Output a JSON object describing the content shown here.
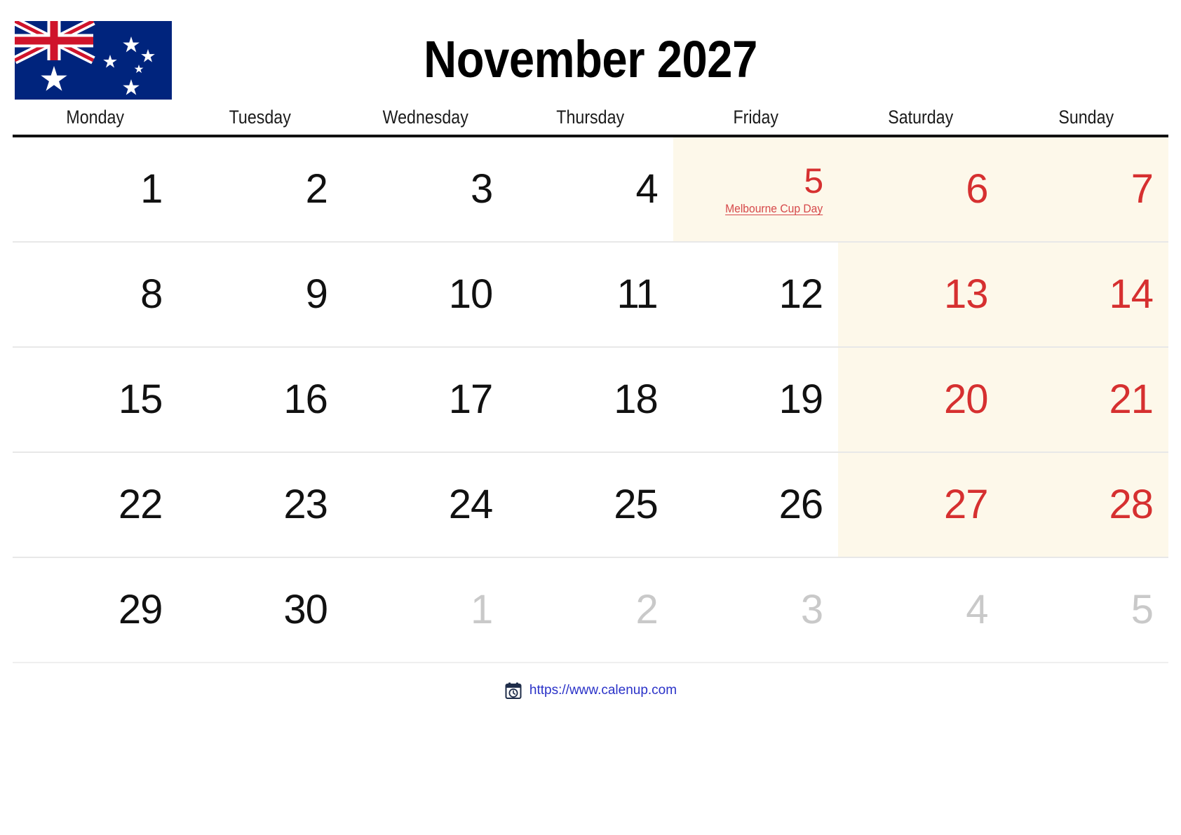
{
  "title": "November 2027",
  "flag": {
    "name": "australian-flag",
    "colors": {
      "navy": "#00247D",
      "red": "#CF142B",
      "white": "#FFFFFF"
    }
  },
  "colors": {
    "weekend_text": "#D63030",
    "muted_text": "#c9c9c9",
    "shaded_cell": "#FDF8EA",
    "event_text": "#D6484A",
    "link": "#2A32C8",
    "header_rule": "#111111"
  },
  "weekdays": [
    "Monday",
    "Tuesday",
    "Wednesday",
    "Thursday",
    "Friday",
    "Saturday",
    "Sunday"
  ],
  "weeks": [
    [
      {
        "day": "1",
        "weekend": false,
        "muted": false,
        "shaded": false,
        "event": ""
      },
      {
        "day": "2",
        "weekend": false,
        "muted": false,
        "shaded": false,
        "event": ""
      },
      {
        "day": "3",
        "weekend": false,
        "muted": false,
        "shaded": false,
        "event": ""
      },
      {
        "day": "4",
        "weekend": false,
        "muted": false,
        "shaded": false,
        "event": ""
      },
      {
        "day": "5",
        "weekend": true,
        "muted": false,
        "shaded": true,
        "event": "Melbourne Cup Day"
      },
      {
        "day": "6",
        "weekend": true,
        "muted": false,
        "shaded": true,
        "event": ""
      },
      {
        "day": "7",
        "weekend": true,
        "muted": false,
        "shaded": true,
        "event": ""
      }
    ],
    [
      {
        "day": "8",
        "weekend": false,
        "muted": false,
        "shaded": false,
        "event": ""
      },
      {
        "day": "9",
        "weekend": false,
        "muted": false,
        "shaded": false,
        "event": ""
      },
      {
        "day": "10",
        "weekend": false,
        "muted": false,
        "shaded": false,
        "event": ""
      },
      {
        "day": "11",
        "weekend": false,
        "muted": false,
        "shaded": false,
        "event": ""
      },
      {
        "day": "12",
        "weekend": false,
        "muted": false,
        "shaded": false,
        "event": ""
      },
      {
        "day": "13",
        "weekend": true,
        "muted": false,
        "shaded": true,
        "event": ""
      },
      {
        "day": "14",
        "weekend": true,
        "muted": false,
        "shaded": true,
        "event": ""
      }
    ],
    [
      {
        "day": "15",
        "weekend": false,
        "muted": false,
        "shaded": false,
        "event": ""
      },
      {
        "day": "16",
        "weekend": false,
        "muted": false,
        "shaded": false,
        "event": ""
      },
      {
        "day": "17",
        "weekend": false,
        "muted": false,
        "shaded": false,
        "event": ""
      },
      {
        "day": "18",
        "weekend": false,
        "muted": false,
        "shaded": false,
        "event": ""
      },
      {
        "day": "19",
        "weekend": false,
        "muted": false,
        "shaded": false,
        "event": ""
      },
      {
        "day": "20",
        "weekend": true,
        "muted": false,
        "shaded": true,
        "event": ""
      },
      {
        "day": "21",
        "weekend": true,
        "muted": false,
        "shaded": true,
        "event": ""
      }
    ],
    [
      {
        "day": "22",
        "weekend": false,
        "muted": false,
        "shaded": false,
        "event": ""
      },
      {
        "day": "23",
        "weekend": false,
        "muted": false,
        "shaded": false,
        "event": ""
      },
      {
        "day": "24",
        "weekend": false,
        "muted": false,
        "shaded": false,
        "event": ""
      },
      {
        "day": "25",
        "weekend": false,
        "muted": false,
        "shaded": false,
        "event": ""
      },
      {
        "day": "26",
        "weekend": false,
        "muted": false,
        "shaded": false,
        "event": ""
      },
      {
        "day": "27",
        "weekend": true,
        "muted": false,
        "shaded": true,
        "event": ""
      },
      {
        "day": "28",
        "weekend": true,
        "muted": false,
        "shaded": true,
        "event": ""
      }
    ],
    [
      {
        "day": "29",
        "weekend": false,
        "muted": false,
        "shaded": false,
        "event": ""
      },
      {
        "day": "30",
        "weekend": false,
        "muted": false,
        "shaded": false,
        "event": ""
      },
      {
        "day": "1",
        "weekend": false,
        "muted": true,
        "shaded": false,
        "event": ""
      },
      {
        "day": "2",
        "weekend": false,
        "muted": true,
        "shaded": false,
        "event": ""
      },
      {
        "day": "3",
        "weekend": false,
        "muted": true,
        "shaded": false,
        "event": ""
      },
      {
        "day": "4",
        "weekend": false,
        "muted": true,
        "shaded": false,
        "event": ""
      },
      {
        "day": "5",
        "weekend": false,
        "muted": true,
        "shaded": false,
        "event": ""
      }
    ]
  ],
  "footer": {
    "icon": "calendar-clock-icon",
    "link_text": "https://www.calenup.com"
  }
}
